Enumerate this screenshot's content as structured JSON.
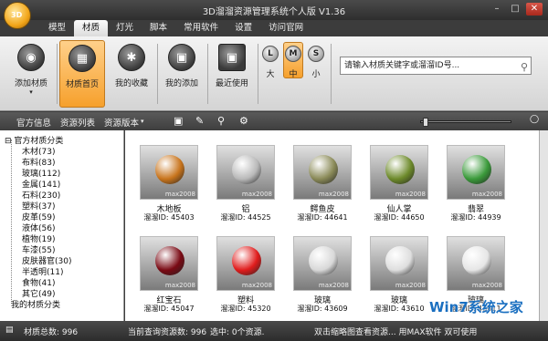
{
  "app": {
    "title": "3D溜溜资源管理系统个人版 V1.36",
    "logo_text": "3D"
  },
  "menu_tabs": [
    "模型",
    "材质",
    "灯光",
    "脚本",
    "常用软件",
    "设置",
    "访问官网"
  ],
  "ribbon": {
    "add_material": "添加材质",
    "material_home": "材质首页",
    "my_favorites": "我的收藏",
    "my_added": "我的添加",
    "recent": "最近使用",
    "size_large": "大",
    "size_medium": "中",
    "size_small": "小",
    "size_large_letter": "L",
    "size_medium_letter": "M",
    "size_small_letter": "S",
    "search_placeholder": "请输入材质关键字或溜溜ID号..."
  },
  "toolbar": {
    "official_info": "官方信息",
    "resource_list": "资源列表",
    "resource_version": "资源版本"
  },
  "tree": {
    "root": "官方材质分类",
    "children": [
      "木材(73)",
      "布料(83)",
      "玻璃(112)",
      "金属(141)",
      "石料(230)",
      "塑料(37)",
      "皮革(59)",
      "液体(56)",
      "植物(19)",
      "车漆(55)",
      "皮肤器官(30)",
      "半透明(11)",
      "食物(41)",
      "其它(49)"
    ],
    "my": "我的材质分类"
  },
  "materials": [
    {
      "name": "木地板",
      "id": "溜溜ID: 45403",
      "color": "#c8741c"
    },
    {
      "name": "铝",
      "id": "溜溜ID: 44525",
      "color": "#b9b9b9"
    },
    {
      "name": "鳄鱼皮",
      "id": "溜溜ID: 44641",
      "color": "#8a8a58"
    },
    {
      "name": "仙人掌",
      "id": "溜溜ID: 44650",
      "color": "#6d8a2a"
    },
    {
      "name": "翡翠",
      "id": "溜溜ID: 44939",
      "color": "#3a9a3a"
    },
    {
      "name": "红宝石",
      "id": "溜溜ID: 45047",
      "color": "#7a0a14"
    },
    {
      "name": "塑料",
      "id": "溜溜ID: 45320",
      "color": "#e01c1c"
    },
    {
      "name": "玻璃",
      "id": "溜溜ID: 43609",
      "color": "#d8d8d8"
    },
    {
      "name": "玻璃",
      "id": "溜溜ID: 43610",
      "color": "#dedede"
    },
    {
      "name": "玻璃",
      "id": "溜溜ID: 43611",
      "color": "#e6e6e6"
    }
  ],
  "thumb_label": "max2008",
  "status": {
    "total": "材质总数: 996",
    "current": "当前查询资源数: 996",
    "selected": "选中: 0个资源.",
    "hint": "双击缩略图查看资源... 用MAX软件 双可使用"
  },
  "watermark": "Win7系统之家"
}
